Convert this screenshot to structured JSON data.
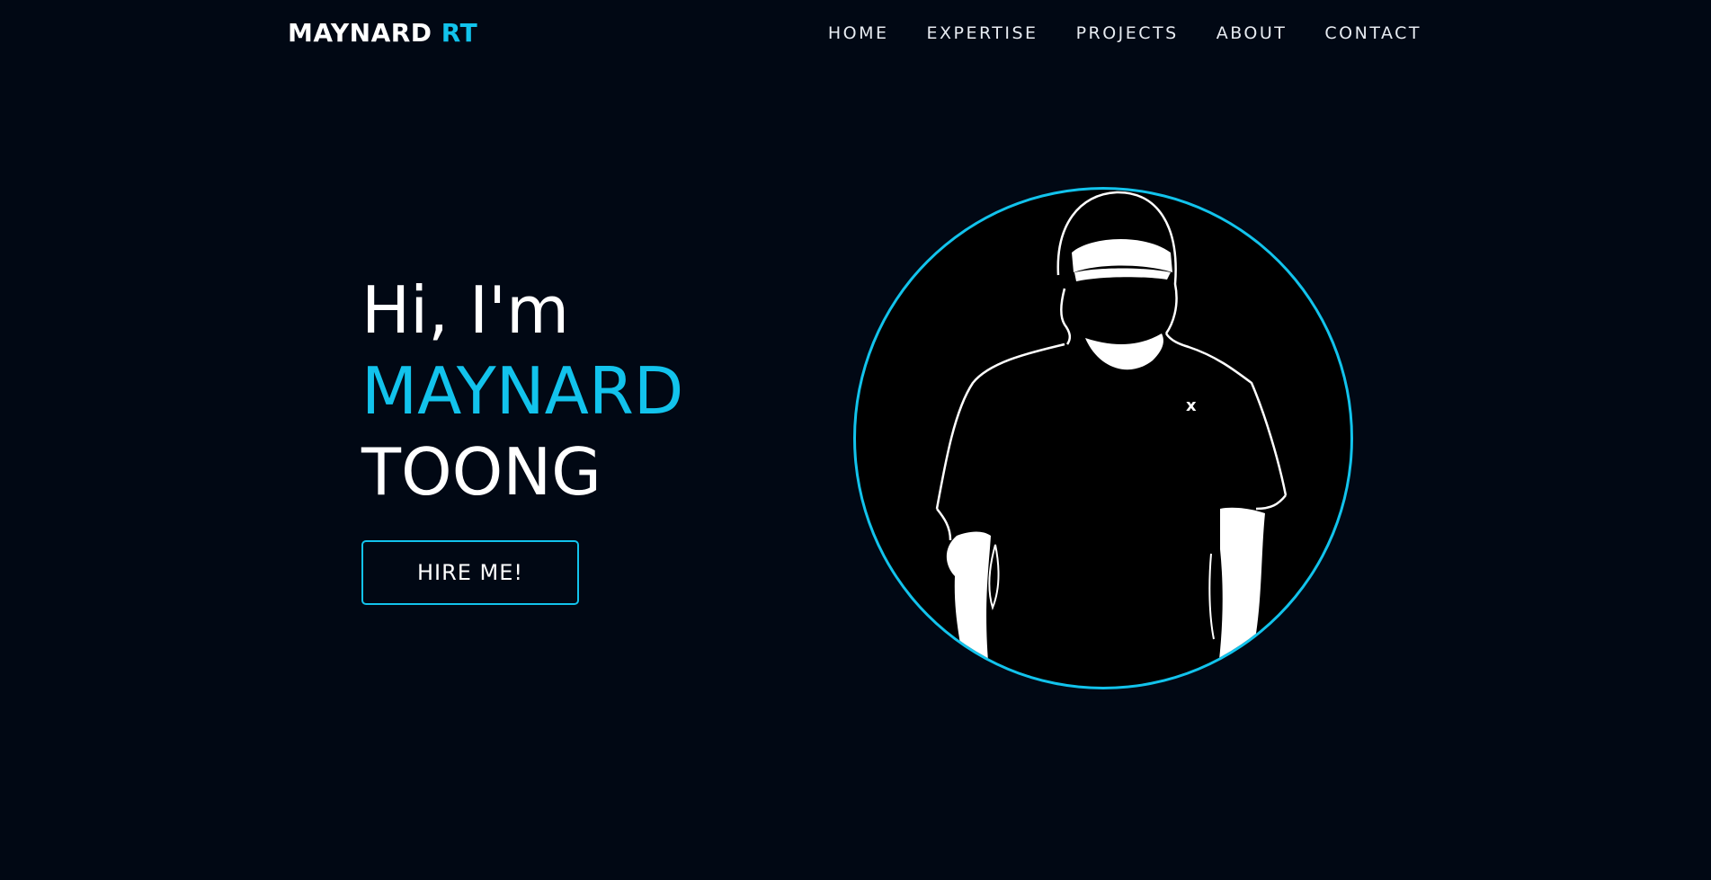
{
  "header": {
    "logo_main": "MAYNARD",
    "logo_accent": "RT",
    "nav": [
      "HOME",
      "EXPERTISE",
      "PROJECTS",
      "ABOUT",
      "CONTACT"
    ]
  },
  "hero": {
    "greeting": "Hi, I'm",
    "first_name": "MAYNARD",
    "last_name": "TOONG",
    "cta_label": "HIRE ME!"
  },
  "colors": {
    "background": "#010814",
    "accent": "#12c3ec",
    "text": "#ffffff"
  }
}
